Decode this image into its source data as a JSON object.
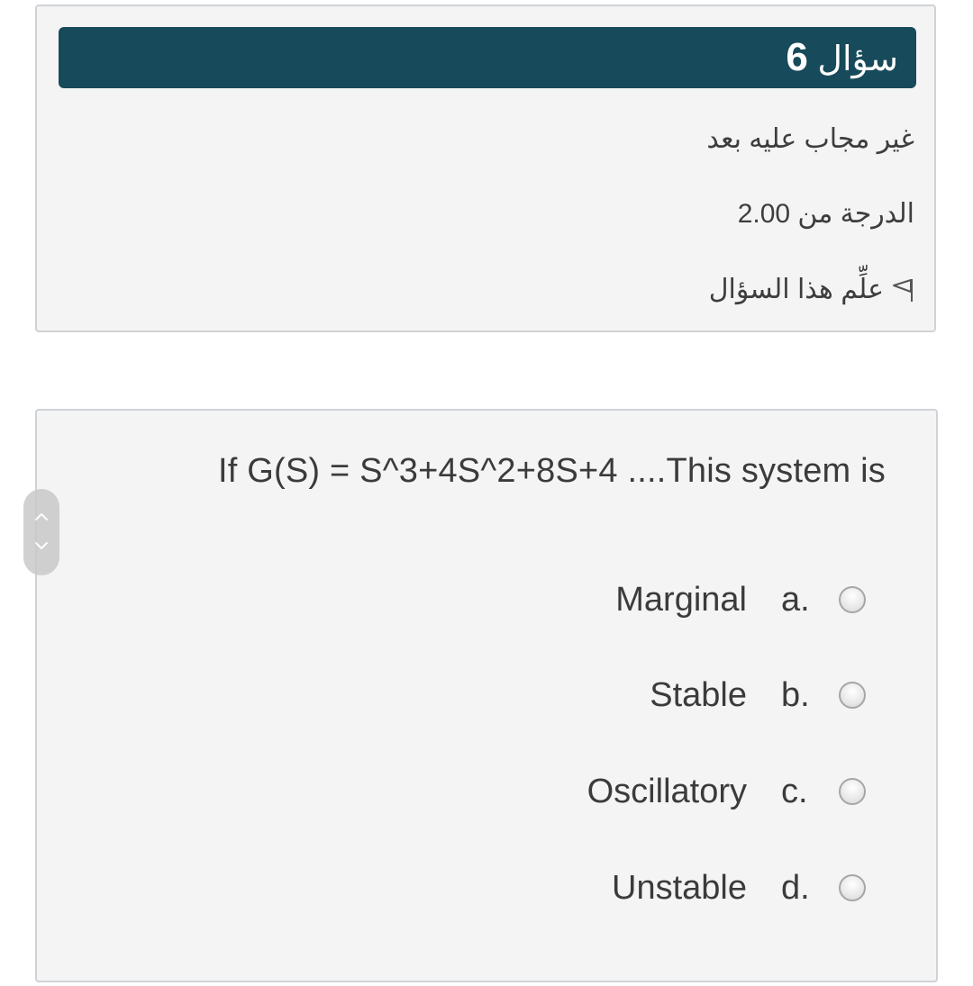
{
  "question_info": {
    "title_word": "سؤال",
    "number": "6",
    "status": "غير مجاب عليه بعد",
    "grade": "الدرجة من 2.00",
    "flag_label": "علِّم هذا السؤال",
    "flag_icon": "flag-icon"
  },
  "question": {
    "text": "If G(S) = S^3+4S^2+8S+4 ....This system is",
    "answers": [
      {
        "letter": "a.",
        "label": "Marginal"
      },
      {
        "letter": "b.",
        "label": "Stable"
      },
      {
        "letter": "c.",
        "label": "Oscillatory"
      },
      {
        "letter": "d.",
        "label": "Unstable"
      }
    ]
  },
  "nav": {
    "up_icon": "chevron-up-icon",
    "down_icon": "chevron-down-icon"
  },
  "colors": {
    "header_bg": "#174a5a",
    "card_bg": "#f4f4f4",
    "card_border": "#cfd3d7"
  }
}
